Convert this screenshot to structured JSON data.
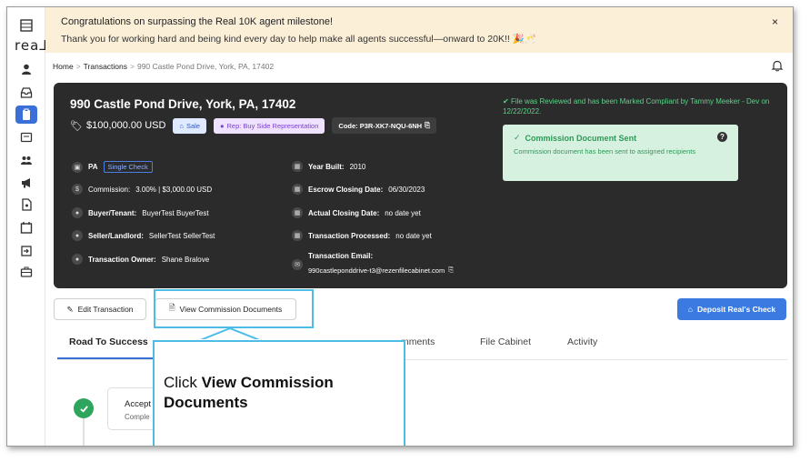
{
  "sidebar": {
    "logo": "rea⅃",
    "items": [
      {
        "icon": "grid-icon"
      },
      {
        "icon": "user-icon"
      },
      {
        "icon": "inbox-icon"
      },
      {
        "icon": "clipboard-icon",
        "active": true
      },
      {
        "icon": "card-icon"
      },
      {
        "icon": "people-icon"
      },
      {
        "icon": "megaphone-icon"
      },
      {
        "icon": "document-icon"
      },
      {
        "icon": "calendar-icon"
      },
      {
        "icon": "login-icon"
      },
      {
        "icon": "briefcase-icon"
      }
    ]
  },
  "banner": {
    "title": "Congratulations on surpassing the Real 10K agent milestone!",
    "text": "Thank you for working hard and being kind every day to help make all agents successful—onward to 20K!! 🎉🥂",
    "close": "×"
  },
  "breadcrumb": {
    "home": "Home",
    "transactions": "Transactions",
    "current": "990 Castle Pond Drive, York, PA, 17402",
    "separator": ">"
  },
  "transaction": {
    "address": "990 Castle Pond Drive, York, PA, 17402",
    "price": "$100,000.00 USD",
    "sale_label": "Sale",
    "rep_label": "Rep: Buy Side Representation",
    "code": "Code: P3R-XK7-NQU-6NH",
    "state": "PA",
    "single_check": "Single Check",
    "commission_label": "Commission:",
    "commission_value": "3.00% | $3,000.00 USD",
    "buyer_label": "Buyer/Tenant:",
    "buyer_value": "BuyerTest BuyerTest",
    "seller_label": "Seller/Landlord:",
    "seller_value": "SellerTest SellerTest",
    "owner_label": "Transaction Owner:",
    "owner_value": "Shane Bralove",
    "year_label": "Year Built:",
    "year_value": "2010",
    "escrow_label": "Escrow Closing Date:",
    "escrow_value": "06/30/2023",
    "actual_label": "Actual Closing Date:",
    "actual_value": "no date yet",
    "processed_label": "Transaction Processed:",
    "processed_value": "no date yet",
    "email_label": "Transaction Email:",
    "email_value": "990castleponddrive-t3@rezenfilecabinet.com",
    "compliant_text": "File was Reviewed and has been Marked Compliant by Tammy Meeker - Dev on 12/22/2022.",
    "commission_sent_title": "Commission Document Sent",
    "commission_sent_text": "Commission document has been sent to assigned recipients",
    "help": "?"
  },
  "actions": {
    "edit": "Edit Transaction",
    "view": "View Commission Documents",
    "deposit": "Deposit Real's Check"
  },
  "tabs": [
    {
      "label": "Road To Success",
      "active": true
    },
    {
      "label": "mments"
    },
    {
      "label": "File Cabinet"
    },
    {
      "label": "Activity"
    }
  ],
  "step": {
    "title": "Accept",
    "sub": "Comple"
  },
  "callout": {
    "prefix": "Click ",
    "bold": "View Commission Documents"
  },
  "colors": {
    "accent": "#3b6fd8",
    "callout_border": "#4dbde8",
    "success": "#2ea55d",
    "banner_bg": "#fcefd8",
    "card_bg": "#2b2b2b"
  }
}
